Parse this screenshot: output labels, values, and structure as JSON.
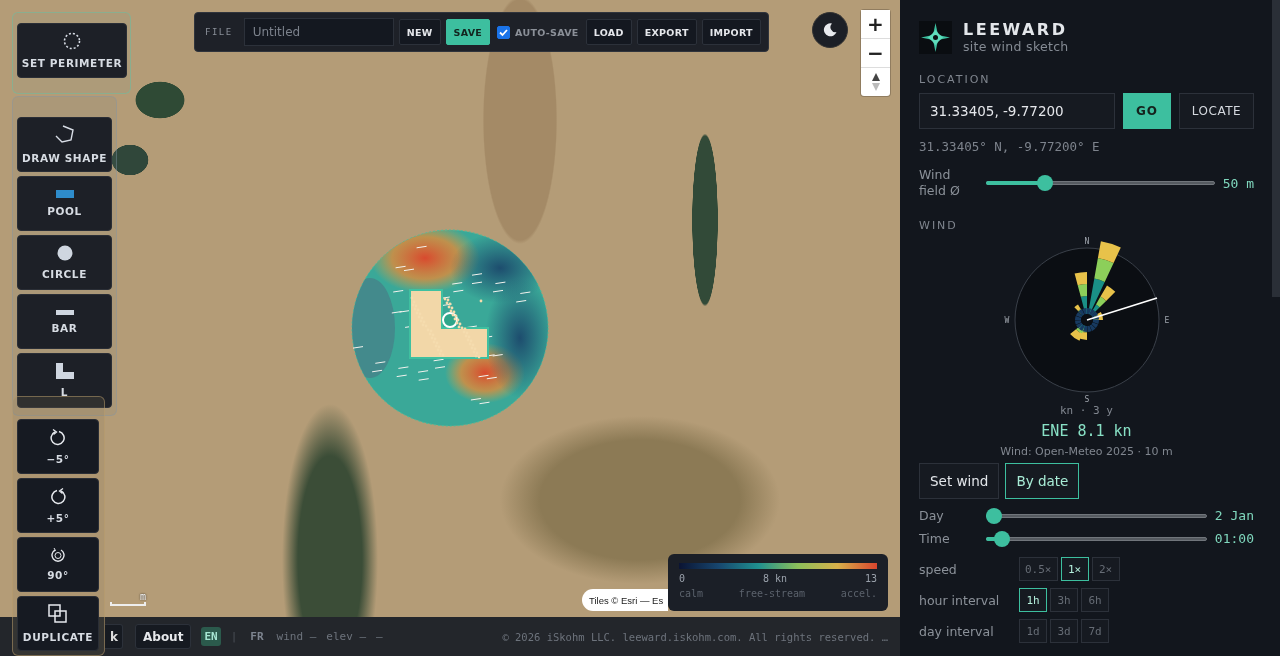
{
  "toolbar": {
    "file_label": "FILE",
    "file_name": {
      "placeholder": "Untitled"
    },
    "buttons": [
      {
        "label": "NEW",
        "kind": "plain"
      },
      {
        "label": "SAVE",
        "kind": "primary"
      }
    ],
    "autosave": {
      "label": "AUTO-SAVE",
      "checked": true
    },
    "more_buttons": [
      {
        "label": "LOAD",
        "kind": "plain"
      },
      {
        "label": "EXPORT",
        "kind": "plain"
      },
      {
        "label": "IMPORT",
        "kind": "plain"
      }
    ]
  },
  "zoom_controls": [
    "+",
    "−"
  ],
  "perimeter_tool": {
    "label": "SET PERIMETER"
  },
  "shape_tools": [
    {
      "label": "DRAW SHAPE",
      "kind": "polygon"
    },
    {
      "label": "POOL",
      "kind": "pool"
    },
    {
      "label": "CIRCLE",
      "kind": "circle"
    },
    {
      "label": "BAR",
      "kind": "bar"
    },
    {
      "label": "L",
      "kind": "l-shape"
    }
  ],
  "transform_tools": [
    {
      "label": "−5°",
      "kind": "rotate-ccw"
    },
    {
      "label": "+5°",
      "kind": "rotate-cw"
    },
    {
      "label": "90°",
      "kind": "rotate-90"
    },
    {
      "label": "DUPLICATE",
      "kind": "duplicate"
    }
  ],
  "scale_bar": {
    "label": "m"
  },
  "attribution": "Tiles © Esri — Es",
  "legend": {
    "ticks": [
      "0",
      "8 kn",
      "13"
    ],
    "zones": [
      "calm",
      "free-stream",
      "accel."
    ]
  },
  "footer": {
    "partial_button": "k",
    "about": "About",
    "languages": [
      {
        "code": "EN",
        "selected": true
      },
      {
        "code": "FR",
        "selected": false
      }
    ],
    "separator": "|",
    "readouts": [
      "wind —",
      "elev —",
      "—"
    ],
    "copyright": "© 2026 iSkohm LLC. leeward.iskohm.com. All rights reserved. …"
  },
  "panel": {
    "brand": {
      "name": "LEEWARD",
      "tagline": "site wind sketch"
    },
    "location": {
      "heading": "LOCATION",
      "coords_input": {
        "value": "31.33405, -9.77200"
      },
      "go": "GO",
      "locate": "LOCATE",
      "readout": "31.33405° N, -9.77200° E",
      "wind_field": {
        "label": "Wind field Ø",
        "level": 0.24,
        "reading": "50 m"
      }
    },
    "wind": {
      "heading": "WIND",
      "rose": {
        "compass": [
          "N",
          "E",
          "S",
          "W"
        ],
        "caption": "kn · 3 y"
      },
      "current": "ENE 8.1 kn",
      "source": "Wind: Open-Meteo 2025 · 10 m",
      "modes": [
        {
          "label": "Set wind",
          "selected": false
        },
        {
          "label": "By date",
          "selected": true
        }
      ],
      "sliders": [
        {
          "label": "Day",
          "level": 0,
          "reading": "2 Jan"
        },
        {
          "label": "Time",
          "level": 0.04,
          "reading": "01:00"
        }
      ],
      "option_rows": [
        {
          "label": "speed",
          "options": [
            {
              "label": "0.5×",
              "selected": false
            },
            {
              "label": "1×",
              "selected": true
            },
            {
              "label": "2×",
              "selected": false
            }
          ]
        },
        {
          "label": "hour interval",
          "options": [
            {
              "label": "1h",
              "selected": true
            },
            {
              "label": "3h",
              "selected": false
            },
            {
              "label": "6h",
              "selected": false
            }
          ]
        },
        {
          "label": "day interval",
          "options": [
            {
              "label": "1d",
              "selected": false
            },
            {
              "label": "3d",
              "selected": false
            },
            {
              "label": "7d",
              "selected": false
            }
          ]
        }
      ]
    }
  }
}
